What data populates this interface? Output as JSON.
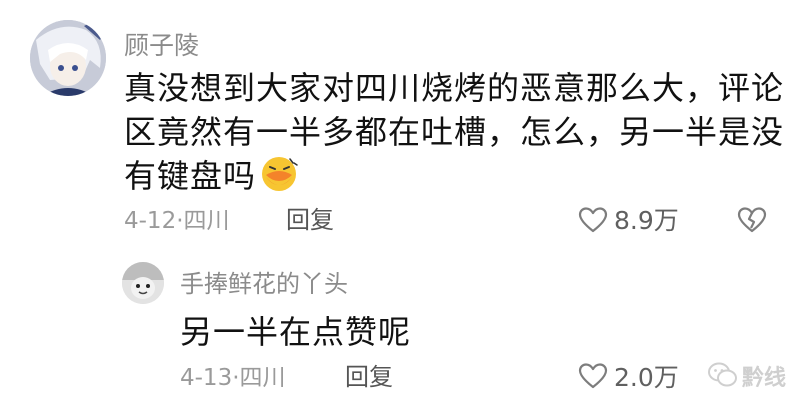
{
  "comment": {
    "username": "顾子陵",
    "text_lines": [
      "真没想到大家对四川烧烤的恶意那么大，评论",
      "区竟然有一半多都在吐槽，怎么，另一半是没",
      "有键盘吗"
    ],
    "date_location": "4-12·四川",
    "reply_label": "回复",
    "like_count": "8.9万"
  },
  "reply": {
    "username": "手捧鲜花的丫头",
    "text": "另一半在点赞呢",
    "date_location": "4-13·四川",
    "reply_label": "回复",
    "like_count": "2.0万"
  },
  "watermark": {
    "text": "黔线"
  },
  "icons": {
    "like": "heart-outline-icon",
    "dislike": "broken-heart-icon",
    "emoji": "grinning-duck-emoji-icon",
    "watermark": "wechat-logo-icon"
  }
}
